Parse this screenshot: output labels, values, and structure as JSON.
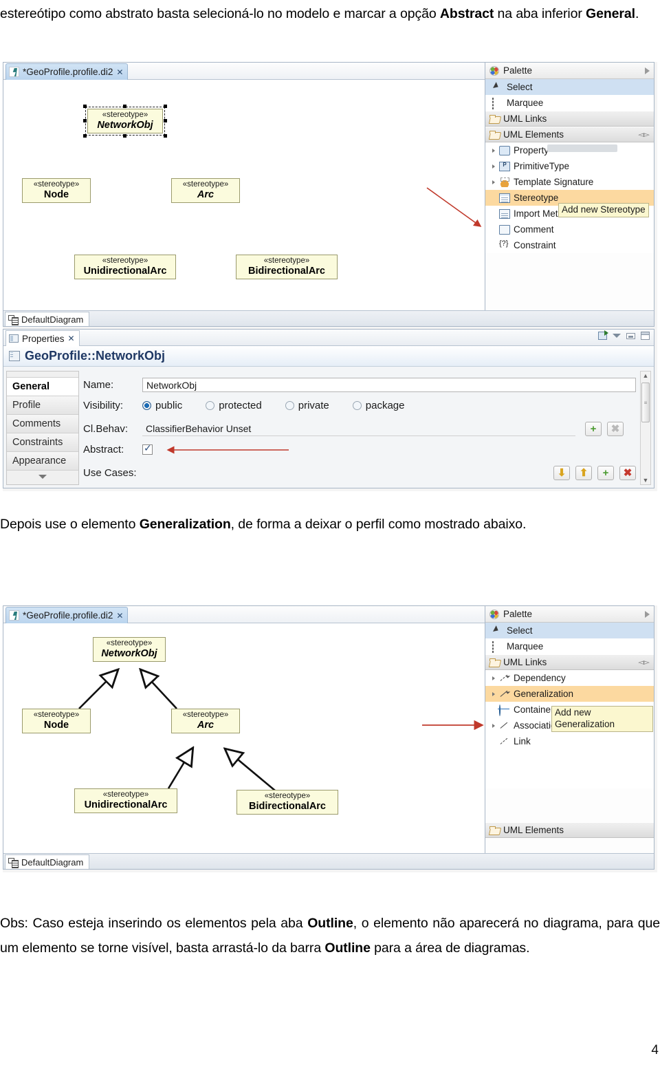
{
  "document": {
    "intro_paragraph": {
      "before": "estereótipo como abstrato basta selecioná-lo no modelo e marcar a opção ",
      "bold1": "Abstract",
      "middle": " na aba inferior ",
      "bold2": "General",
      "after": "."
    },
    "mid_paragraph": {
      "before": "Depois use o elemento ",
      "bold1": "Generalization",
      "after": ", de forma a deixar o perfil como mostrado abaixo."
    },
    "obs_paragraph": {
      "before": "Obs: Caso esteja inserindo os elementos pela aba ",
      "bold1": "Outline",
      "middle": ", o elemento não aparecerá no diagrama, para que um elemento se torne visível, basta arrastá-lo da barra ",
      "bold2": "Outline",
      "after": " para a área de diagramas."
    },
    "page_number": "4"
  },
  "colors": {
    "uml_box_fill": "#fbfbdd",
    "uml_box_border": "#9a9a6b",
    "selection_blue": "#cfe0f2",
    "selection_orange": "#fcd9a0",
    "tooltip_bg": "#fbf7cf",
    "red_annotation": "#c0392b",
    "header_text": "#1f3864"
  },
  "screenshot1": {
    "editor": {
      "tab_label": "*GeoProfile.profile.di2",
      "tab_close": "✕",
      "window_minimize": "minimize",
      "window_maximize": "maximize"
    },
    "diagram": {
      "bottom_tab": "DefaultDiagram",
      "elements": [
        {
          "stereotype": "«stereotype»",
          "name": "NetworkObj",
          "abstract": true,
          "selected": true
        },
        {
          "stereotype": "«stereotype»",
          "name": "Node",
          "abstract": false,
          "selected": false
        },
        {
          "stereotype": "«stereotype»",
          "name": "Arc",
          "abstract": true,
          "selected": false
        },
        {
          "stereotype": "«stereotype»",
          "name": "UnidirectionalArc",
          "abstract": false,
          "selected": false
        },
        {
          "stereotype": "«stereotype»",
          "name": "BidirectionalArc",
          "abstract": false,
          "selected": false
        }
      ]
    },
    "palette": {
      "title": "Palette",
      "tools": [
        {
          "label": "Select",
          "icon": "cursor-icon",
          "state": "selected"
        },
        {
          "label": "Marquee",
          "icon": "marquee-icon",
          "state": "normal"
        }
      ],
      "groups": [
        {
          "label": "UML Links",
          "icon": "folder-icon",
          "collapsed": true,
          "items": []
        },
        {
          "label": "UML Elements",
          "icon": "folder-icon",
          "collapsed": false,
          "items": [
            {
              "label": "Property",
              "icon": "property-icon",
              "expandable": true,
              "state": "normal"
            },
            {
              "label": "PrimitiveType",
              "icon": "primitive-type-icon",
              "expandable": true,
              "state": "normal"
            },
            {
              "label": "Template Signature",
              "icon": "template-signature-icon",
              "expandable": true,
              "state": "normal"
            },
            {
              "label": "Stereotype",
              "icon": "stereotype-icon",
              "expandable": false,
              "state": "highlighted"
            },
            {
              "label": "Import Metaclass",
              "icon": "import-metaclass-icon",
              "expandable": false,
              "state": "normal"
            },
            {
              "label": "Comment",
              "icon": "comment-icon",
              "expandable": false,
              "state": "normal"
            },
            {
              "label": "Constraint",
              "icon": "constraint-icon",
              "expandable": false,
              "state": "normal"
            }
          ]
        }
      ],
      "tooltip": "Add new Stereotype"
    },
    "properties": {
      "tab_label": "Properties",
      "tab_close": "✕",
      "header": "GeoProfile::NetworkObj",
      "side_tabs": [
        {
          "label": "General",
          "active": true
        },
        {
          "label": "Profile",
          "active": false
        },
        {
          "label": "Comments",
          "active": false
        },
        {
          "label": "Constraints",
          "active": false
        },
        {
          "label": "Appearance",
          "active": false
        }
      ],
      "fields": {
        "name_label": "Name:",
        "name_value": "NetworkObj",
        "visibility_label": "Visibility:",
        "visibility_options": [
          {
            "label": "public",
            "selected": true
          },
          {
            "label": "protected",
            "selected": false
          },
          {
            "label": "private",
            "selected": false
          },
          {
            "label": "package",
            "selected": false
          }
        ],
        "clbehav_label": "Cl.Behav:",
        "clbehav_value": "ClassifierBehavior Unset",
        "abstract_label": "Abstract:",
        "abstract_checked": true,
        "usecases_label": "Use Cases:"
      },
      "buttons": {
        "clbehav_add": "+",
        "clbehav_remove": "✖",
        "usecases_down": "⬇",
        "usecases_up": "⬆",
        "usecases_add": "+",
        "usecases_delete": "✖"
      }
    }
  },
  "screenshot2": {
    "editor": {
      "tab_label": "*GeoProfile.profile.di2",
      "tab_close": "✕",
      "window_minimize": "minimize",
      "window_maximize": "maximize"
    },
    "diagram": {
      "bottom_tab": "DefaultDiagram",
      "elements": [
        {
          "stereotype": "«stereotype»",
          "name": "NetworkObj",
          "abstract": true
        },
        {
          "stereotype": "«stereotype»",
          "name": "Node",
          "abstract": false
        },
        {
          "stereotype": "«stereotype»",
          "name": "Arc",
          "abstract": true
        },
        {
          "stereotype": "«stereotype»",
          "name": "UnidirectionalArc",
          "abstract": false
        },
        {
          "stereotype": "«stereotype»",
          "name": "BidirectionalArc",
          "abstract": false
        }
      ],
      "generalizations": [
        {
          "from": "Node",
          "to": "NetworkObj"
        },
        {
          "from": "Arc",
          "to": "NetworkObj"
        },
        {
          "from": "UnidirectionalArc",
          "to": "Arc"
        },
        {
          "from": "BidirectionalArc",
          "to": "Arc"
        }
      ]
    },
    "palette": {
      "title": "Palette",
      "tools": [
        {
          "label": "Select",
          "icon": "cursor-icon",
          "state": "selected"
        },
        {
          "label": "Marquee",
          "icon": "marquee-icon",
          "state": "normal"
        }
      ],
      "groups": [
        {
          "label": "UML Links",
          "icon": "folder-icon",
          "collapsed": false,
          "items": [
            {
              "label": "Dependency",
              "icon": "dependency-icon",
              "expandable": true,
              "state": "normal"
            },
            {
              "label": "Generalization",
              "icon": "generalization-icon",
              "expandable": true,
              "state": "highlighted"
            },
            {
              "label": "Containement Connection",
              "icon": "containment-icon",
              "expandable": false,
              "state": "normal"
            },
            {
              "label": "Association",
              "icon": "association-icon",
              "expandable": true,
              "state": "normal"
            },
            {
              "label": "Link",
              "icon": "link-icon",
              "expandable": false,
              "state": "normal"
            }
          ]
        },
        {
          "label": "UML Elements",
          "icon": "folder-icon",
          "collapsed": true,
          "items": []
        }
      ],
      "tooltip": "Add new\nGeneralization"
    }
  }
}
